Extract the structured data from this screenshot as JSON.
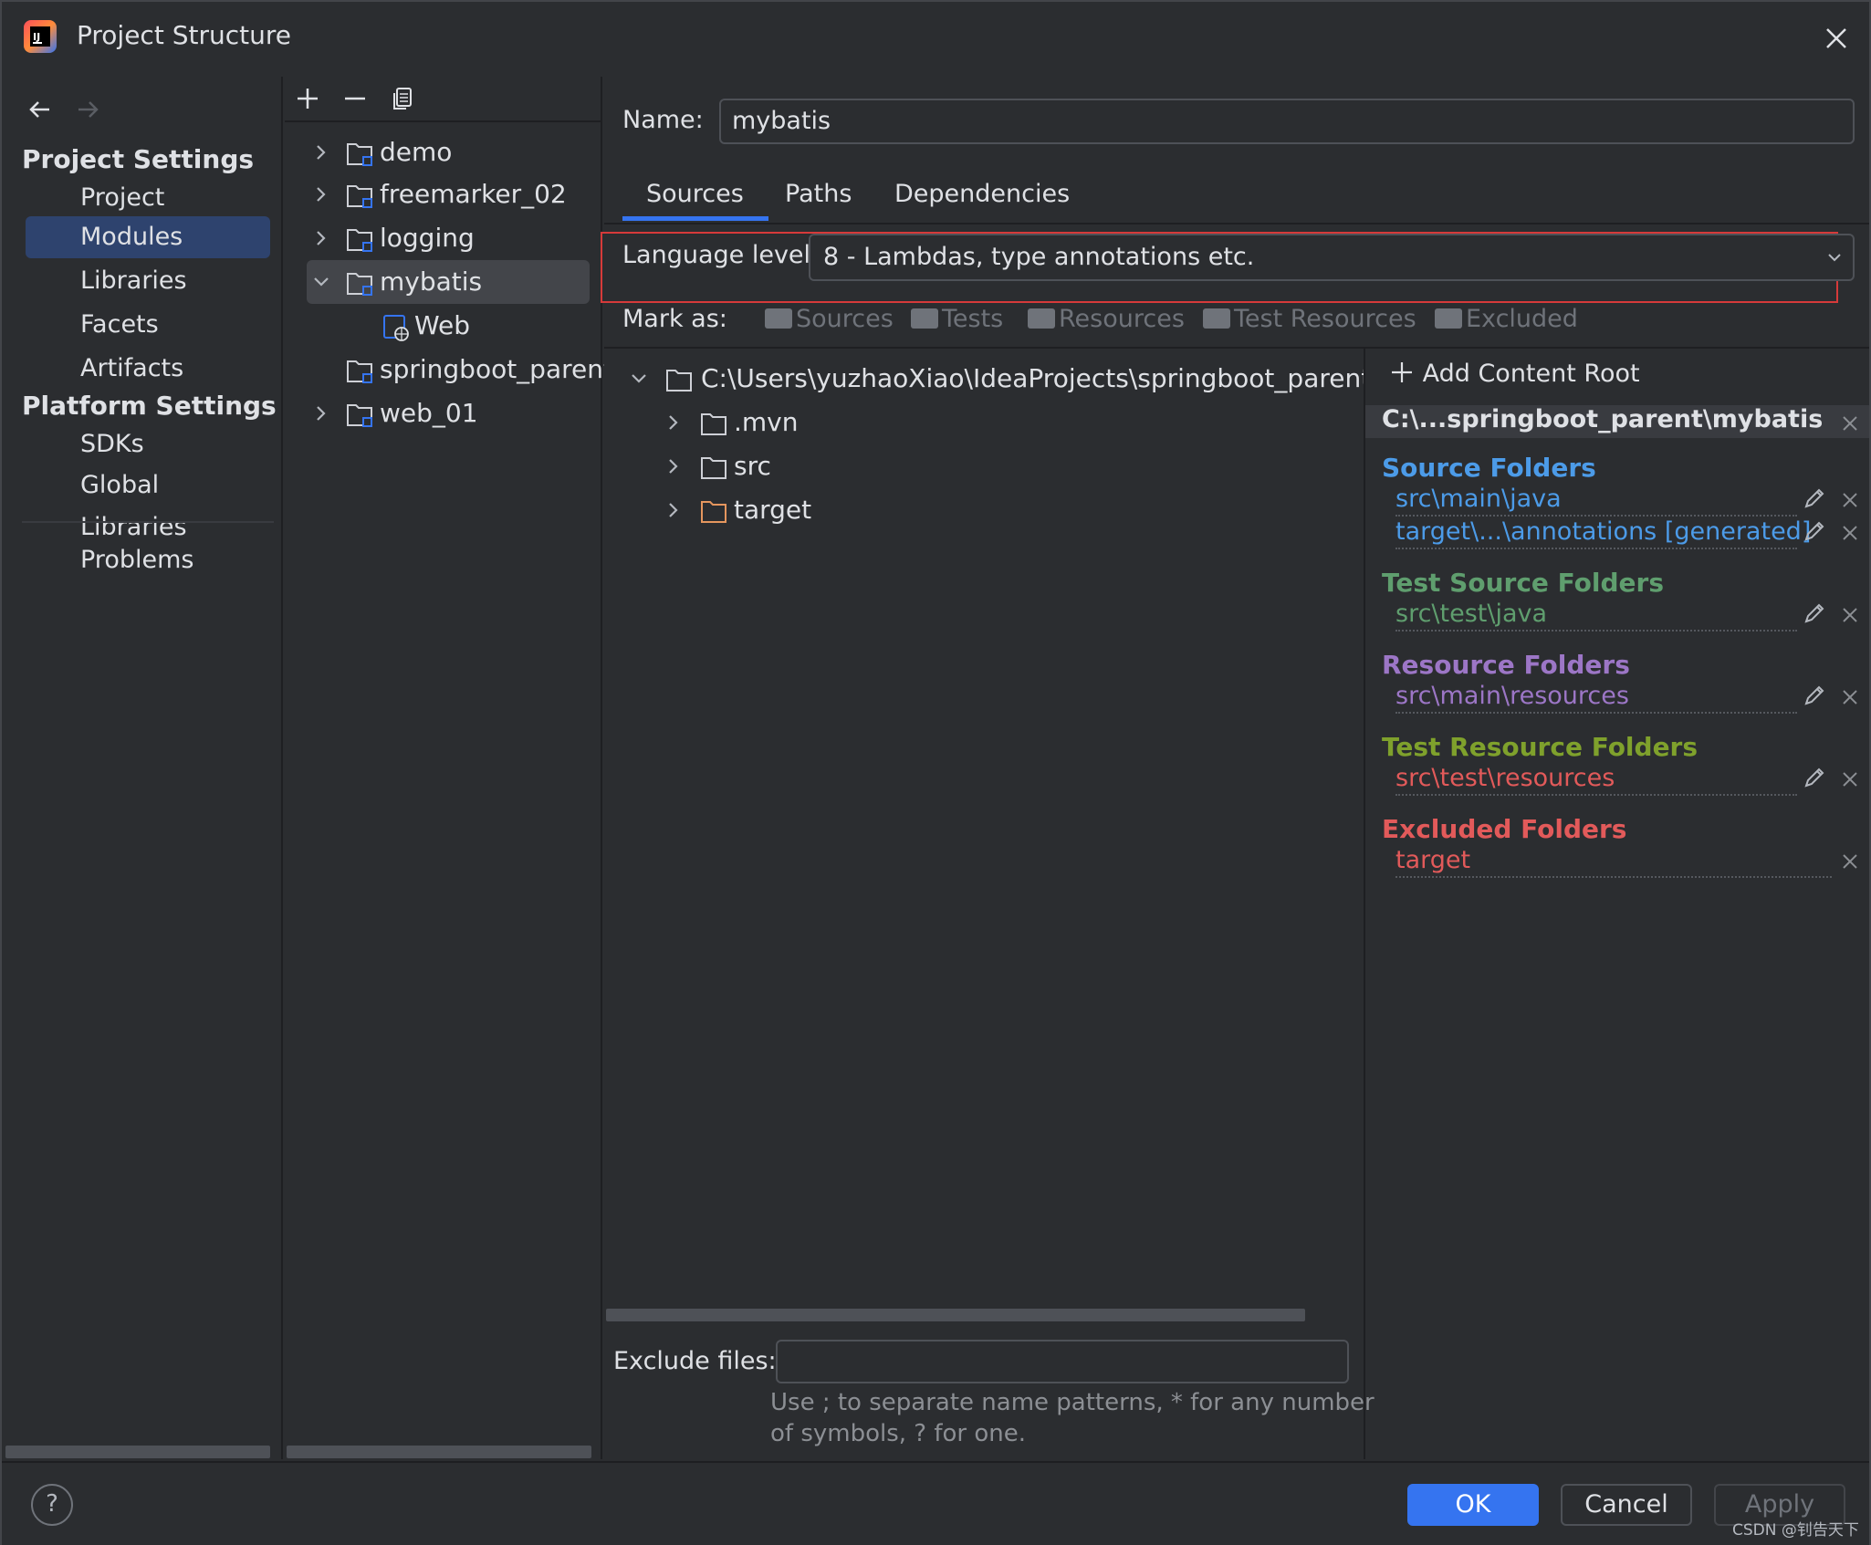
{
  "window": {
    "title": "Project Structure"
  },
  "nav": {
    "project_settings": "Project Settings",
    "project_items": [
      "Project",
      "Modules",
      "Libraries",
      "Facets",
      "Artifacts"
    ],
    "platform_settings": "Platform Settings",
    "platform_items": [
      "SDKs",
      "Global Libraries"
    ],
    "problems": "Problems",
    "selected": "Modules"
  },
  "modules": {
    "items": [
      {
        "name": "demo",
        "expanded": false
      },
      {
        "name": "freemarker_02",
        "expanded": false
      },
      {
        "name": "logging",
        "expanded": false
      },
      {
        "name": "mybatis",
        "expanded": true,
        "selected": true
      },
      {
        "name": "Web",
        "child": true
      },
      {
        "name": "springboot_parent",
        "leaf": true
      },
      {
        "name": "web_01",
        "expanded": false
      }
    ]
  },
  "module": {
    "name_label": "Name:",
    "name_value": "mybatis",
    "tabs": [
      "Sources",
      "Paths",
      "Dependencies"
    ],
    "selected_tab": "Sources",
    "language_level_label": "Language level:",
    "language_level_value": "8 - Lambdas, type annotations etc.",
    "mark_as_label": "Mark as:",
    "mark_as": [
      "Sources",
      "Tests",
      "Resources",
      "Test Resources",
      "Excluded"
    ]
  },
  "file_tree": {
    "root": "C:\\Users\\yuzhaoXiao\\IdeaProjects\\springboot_parent\\myba",
    "children": [
      ".mvn",
      "src",
      "target"
    ]
  },
  "content_root": {
    "add_label": "Add Content Root",
    "path": "C:\\...springboot_parent\\mybatis",
    "source_folders_title": "Source Folders",
    "source_folders": [
      "src\\main\\java",
      "target\\...\\annotations [generated]"
    ],
    "test_source_folders_title": "Test Source Folders",
    "test_source_folders": [
      "src\\test\\java"
    ],
    "resource_folders_title": "Resource Folders",
    "resource_folders": [
      "src\\main\\resources"
    ],
    "test_resource_folders_title": "Test Resource Folders",
    "test_resource_folders": [
      "src\\test\\resources"
    ],
    "excluded_folders_title": "Excluded Folders",
    "excluded_folders": [
      "target"
    ]
  },
  "exclude": {
    "label": "Exclude files:",
    "value": "",
    "hint_line1": "Use ; to separate name patterns, * for any number",
    "hint_line2": "of symbols, ? for one."
  },
  "buttons": {
    "ok": "OK",
    "cancel": "Cancel",
    "apply": "Apply",
    "help": "?"
  },
  "watermark": "CSDN @钊告天下",
  "colors": {
    "accent": "#3574f0",
    "source": "#4c9be8",
    "test": "#5f9e6e",
    "resource": "#9c76c6",
    "test_resource": "#7fa12c",
    "excluded": "#e25a5a",
    "highlight_box": "#d63a3a"
  }
}
